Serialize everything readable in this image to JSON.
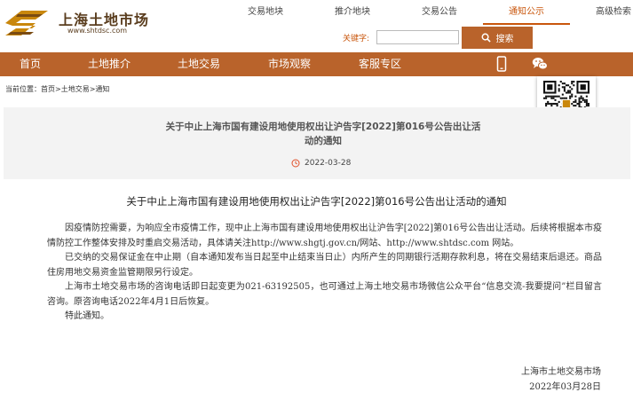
{
  "site": {
    "name_cn": "上海土地市场",
    "url": "www.shtdsc.com"
  },
  "top_nav": [
    {
      "label": "交易地块",
      "active": false
    },
    {
      "label": "推介地块",
      "active": false
    },
    {
      "label": "交易公告",
      "active": false
    },
    {
      "label": "通知公示",
      "active": true
    },
    {
      "label": "高级检索",
      "active": false
    }
  ],
  "search": {
    "label": "关键字:",
    "value": "",
    "placeholder": "",
    "button_label": "搜索"
  },
  "main_nav": [
    "首页",
    "土地推介",
    "土地交易",
    "市场观察",
    "客服专区"
  ],
  "main_nav_icons": [
    "mobile-icon",
    "wechat-icon"
  ],
  "breadcrumb": "当前位置：首页>土地交易>通知",
  "notice": {
    "panel_title": "关于中止上海市国有建设用地使用权出让沪告字[2022]第016号公告出让活动的通知",
    "date": "2022-03-28",
    "article_title": "关于中止上海市国有建设用地使用权出让沪告字[2022]第016号公告出让活动的通知",
    "paragraphs": [
      "因疫情防控需要，为响应全市疫情工作，现中止上海市国有建设用地使用权出让沪告字[2022]第016号公告出让活动。后续将根据本市疫情防控工作整体安排及时重启交易活动，具体请关注http://www.shgtj.gov.cn/网站、http://www.shtdsc.com 网站。",
      "已交纳的交易保证金在中止期（自本通知发布当日起至中止结束当日止）内所产生的同期银行活期存款利息，将在交易结束后退还。商品住房用地交易资金监管期限另行设定。",
      "上海市土地交易市场的咨询电话即日起变更为021-63192505，也可通过上海土地交易市场微信公众平台“信息交流-我要提问”栏目留言咨询。原咨询电话2022年4月1日后恢复。",
      "特此通知。"
    ],
    "signature_org": "上海市土地交易市场",
    "signature_date": "2022年03月28日"
  },
  "colors": {
    "brand": "#b9632b",
    "accent_text": "#c9560c",
    "panel_bg": "#f3f3f3"
  }
}
